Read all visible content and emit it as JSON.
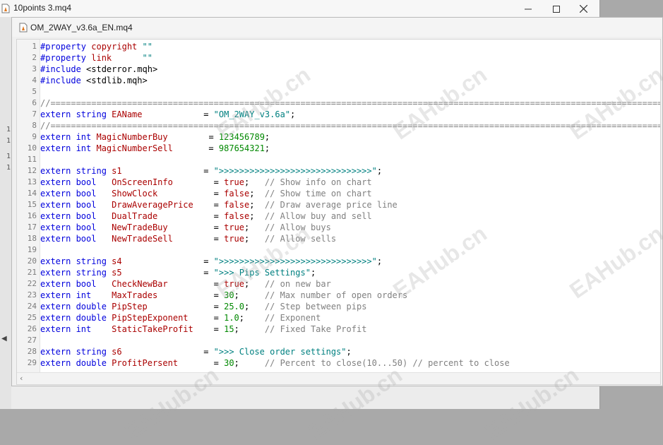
{
  "outer_window": {
    "title": "10points 3.mq4",
    "icon": "mq4-file-icon",
    "controls": {
      "minimize": "minimize-icon",
      "maximize": "maximize-icon",
      "close": "close-icon"
    }
  },
  "editor_window": {
    "title": "OM_2WAY_v3.6a_EN.mq4",
    "icon": "mq4-file-icon"
  },
  "watermark_text": "EAHub.cn",
  "code_lines": [
    {
      "n": "1",
      "tokens": [
        [
          "pre",
          "#property "
        ],
        [
          "ident",
          "copyright"
        ],
        [
          "plain",
          " "
        ],
        [
          "str",
          "\"\""
        ]
      ]
    },
    {
      "n": "2",
      "tokens": [
        [
          "pre",
          "#property "
        ],
        [
          "ident",
          "link"
        ],
        [
          "plain",
          "      "
        ],
        [
          "str",
          "\"\""
        ]
      ]
    },
    {
      "n": "3",
      "tokens": [
        [
          "pre",
          "#include "
        ],
        [
          "inc",
          "<stderror.mqh>"
        ]
      ]
    },
    {
      "n": "4",
      "tokens": [
        [
          "pre",
          "#include "
        ],
        [
          "inc",
          "<stdlib.mqh>"
        ]
      ]
    },
    {
      "n": "5",
      "tokens": []
    },
    {
      "n": "6",
      "tokens": [
        [
          "cmt",
          "//=================================================================================================================================="
        ]
      ]
    },
    {
      "n": "7",
      "tokens": [
        [
          "kw",
          "extern string "
        ],
        [
          "ident",
          "EAName"
        ],
        [
          "plain",
          "            = "
        ],
        [
          "str",
          "\"OM_2WAY_v3.6a\""
        ],
        [
          "plain",
          ";"
        ]
      ]
    },
    {
      "n": "8",
      "tokens": [
        [
          "cmt",
          "//=================================================================================================================================="
        ]
      ]
    },
    {
      "n": "9",
      "tokens": [
        [
          "kw",
          "extern int "
        ],
        [
          "ident",
          "MagicNumberBuy"
        ],
        [
          "plain",
          "        = "
        ],
        [
          "num",
          "123456789"
        ],
        [
          "plain",
          ";"
        ]
      ]
    },
    {
      "n": "10",
      "tokens": [
        [
          "kw",
          "extern int "
        ],
        [
          "ident",
          "MagicNumberSell"
        ],
        [
          "plain",
          "       = "
        ],
        [
          "num",
          "987654321"
        ],
        [
          "plain",
          ";"
        ]
      ]
    },
    {
      "n": "11",
      "tokens": []
    },
    {
      "n": "12",
      "tokens": [
        [
          "kw",
          "extern string "
        ],
        [
          "ident",
          "s1"
        ],
        [
          "plain",
          "                = "
        ],
        [
          "str",
          "\">>>>>>>>>>>>>>>>>>>>>>>>>>>>>>\""
        ],
        [
          "plain",
          ";"
        ]
      ]
    },
    {
      "n": "13",
      "tokens": [
        [
          "kw",
          "extern bool   "
        ],
        [
          "ident",
          "OnScreenInfo"
        ],
        [
          "plain",
          "        = "
        ],
        [
          "ident",
          "true"
        ],
        [
          "plain",
          ";   "
        ],
        [
          "cmt",
          "// Show info on chart"
        ]
      ]
    },
    {
      "n": "14",
      "tokens": [
        [
          "kw",
          "extern bool   "
        ],
        [
          "ident",
          "ShowClock"
        ],
        [
          "plain",
          "           = "
        ],
        [
          "ident",
          "false"
        ],
        [
          "plain",
          ";  "
        ],
        [
          "cmt",
          "// Show time on chart"
        ]
      ]
    },
    {
      "n": "15",
      "tokens": [
        [
          "kw",
          "extern bool   "
        ],
        [
          "ident",
          "DrawAveragePrice"
        ],
        [
          "plain",
          "    = "
        ],
        [
          "ident",
          "false"
        ],
        [
          "plain",
          ";  "
        ],
        [
          "cmt",
          "// Draw average price line"
        ]
      ]
    },
    {
      "n": "16",
      "tokens": [
        [
          "kw",
          "extern bool   "
        ],
        [
          "ident",
          "DualTrade"
        ],
        [
          "plain",
          "           = "
        ],
        [
          "ident",
          "false"
        ],
        [
          "plain",
          ";  "
        ],
        [
          "cmt",
          "// Allow buy and sell"
        ]
      ]
    },
    {
      "n": "17",
      "tokens": [
        [
          "kw",
          "extern bool   "
        ],
        [
          "ident",
          "NewTradeBuy"
        ],
        [
          "plain",
          "         = "
        ],
        [
          "ident",
          "true"
        ],
        [
          "plain",
          ";   "
        ],
        [
          "cmt",
          "// Allow buys"
        ]
      ]
    },
    {
      "n": "18",
      "tokens": [
        [
          "kw",
          "extern bool   "
        ],
        [
          "ident",
          "NewTradeSell"
        ],
        [
          "plain",
          "        = "
        ],
        [
          "ident",
          "true"
        ],
        [
          "plain",
          ";   "
        ],
        [
          "cmt",
          "// Allow sells"
        ]
      ]
    },
    {
      "n": "19",
      "tokens": []
    },
    {
      "n": "20",
      "tokens": [
        [
          "kw",
          "extern string "
        ],
        [
          "ident",
          "s4"
        ],
        [
          "plain",
          "                = "
        ],
        [
          "str",
          "\">>>>>>>>>>>>>>>>>>>>>>>>>>>>>>\""
        ],
        [
          "plain",
          ";"
        ]
      ]
    },
    {
      "n": "21",
      "tokens": [
        [
          "kw",
          "extern string "
        ],
        [
          "ident",
          "s5"
        ],
        [
          "plain",
          "                = "
        ],
        [
          "str",
          "\">>> Pips Settings\""
        ],
        [
          "plain",
          ";"
        ]
      ]
    },
    {
      "n": "22",
      "tokens": [
        [
          "kw",
          "extern bool   "
        ],
        [
          "ident",
          "CheckNewBar"
        ],
        [
          "plain",
          "         = "
        ],
        [
          "ident",
          "true"
        ],
        [
          "plain",
          ";   "
        ],
        [
          "cmt",
          "// on new bar"
        ]
      ]
    },
    {
      "n": "23",
      "tokens": [
        [
          "kw",
          "extern int    "
        ],
        [
          "ident",
          "MaxTrades"
        ],
        [
          "plain",
          "           = "
        ],
        [
          "num",
          "30"
        ],
        [
          "plain",
          ";     "
        ],
        [
          "cmt",
          "// Max number of open orders"
        ]
      ]
    },
    {
      "n": "24",
      "tokens": [
        [
          "kw",
          "extern double "
        ],
        [
          "ident",
          "PipStep"
        ],
        [
          "plain",
          "             = "
        ],
        [
          "num",
          "25.0"
        ],
        [
          "plain",
          ";   "
        ],
        [
          "cmt",
          "// Step between pips"
        ]
      ]
    },
    {
      "n": "25",
      "tokens": [
        [
          "kw",
          "extern double "
        ],
        [
          "ident",
          "PipStepExponent"
        ],
        [
          "plain",
          "     = "
        ],
        [
          "num",
          "1.0"
        ],
        [
          "plain",
          ";    "
        ],
        [
          "cmt",
          "// Exponent"
        ]
      ]
    },
    {
      "n": "26",
      "tokens": [
        [
          "kw",
          "extern int    "
        ],
        [
          "ident",
          "StaticTakeProfit"
        ],
        [
          "plain",
          "    = "
        ],
        [
          "num",
          "15"
        ],
        [
          "plain",
          ";     "
        ],
        [
          "cmt",
          "// Fixed Take Profit"
        ]
      ]
    },
    {
      "n": "27",
      "tokens": []
    },
    {
      "n": "28",
      "tokens": [
        [
          "kw",
          "extern string "
        ],
        [
          "ident",
          "s6"
        ],
        [
          "plain",
          "                = "
        ],
        [
          "str",
          "\">>> Close order settings\""
        ],
        [
          "plain",
          ";"
        ]
      ]
    },
    {
      "n": "29",
      "tokens": [
        [
          "kw",
          "extern double "
        ],
        [
          "ident",
          "ProfitPersent"
        ],
        [
          "plain",
          "       = "
        ],
        [
          "num",
          "30"
        ],
        [
          "plain",
          ";     "
        ],
        [
          "cmt",
          "// Percent to close(10...50) // percent to close"
        ]
      ]
    }
  ]
}
